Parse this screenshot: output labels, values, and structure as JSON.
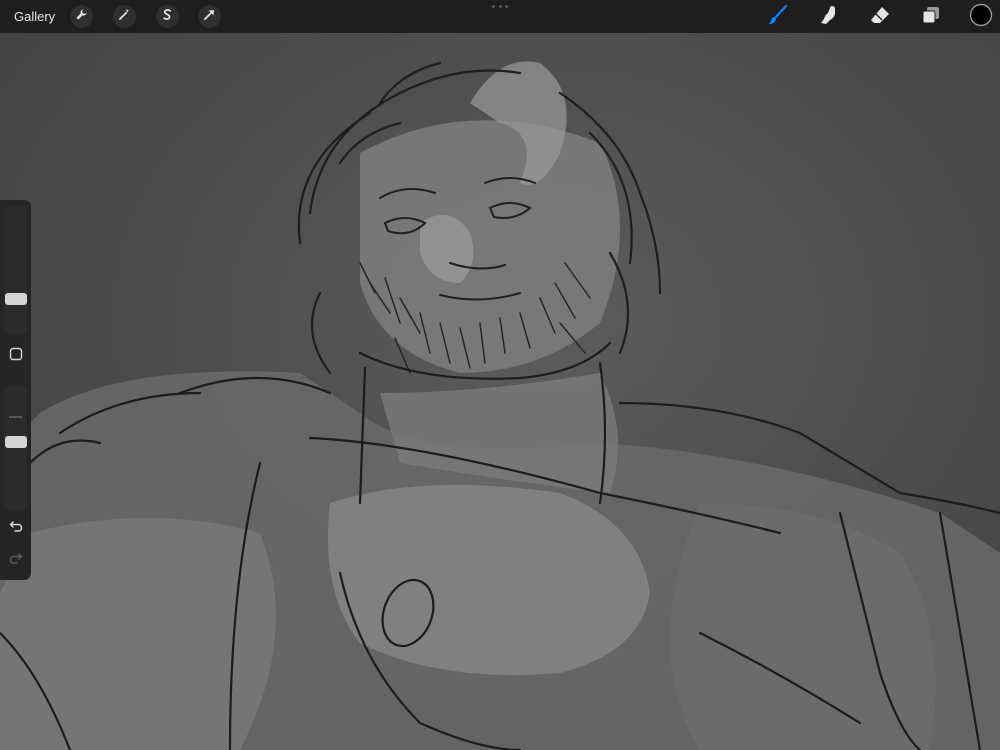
{
  "toolbar": {
    "gallery_label": "Gallery",
    "left_tools": [
      {
        "name": "actions",
        "icon": "wrench-icon"
      },
      {
        "name": "adjustments",
        "icon": "magic-wand-icon"
      },
      {
        "name": "selection",
        "icon": "selection-s-icon"
      },
      {
        "name": "transform",
        "icon": "arrow-cursor-icon"
      }
    ],
    "right_tools": [
      {
        "name": "brush",
        "icon": "brush-icon",
        "active": true
      },
      {
        "name": "smudge",
        "icon": "smudge-finger-icon"
      },
      {
        "name": "eraser",
        "icon": "eraser-icon"
      },
      {
        "name": "layers",
        "icon": "layers-icon"
      },
      {
        "name": "color",
        "icon": "color-swatch-icon"
      }
    ],
    "active_color": "#0a84ff",
    "current_color": "#000000"
  },
  "sidebar": {
    "brush_size": 0.25,
    "opacity": 0.55,
    "modify_icon": "square-modify-icon",
    "undo_icon": "undo-icon",
    "redo_icon": "redo-icon"
  }
}
